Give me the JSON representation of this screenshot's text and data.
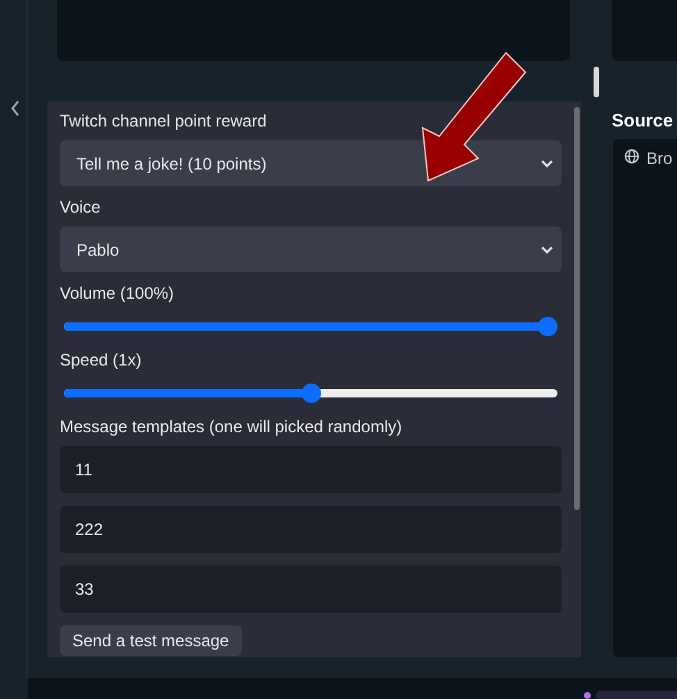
{
  "settings": {
    "fields": [
      {
        "kind": "select",
        "label": "Twitch channel point reward",
        "value": "Tell me a joke! (10 points)"
      },
      {
        "kind": "select",
        "label": "Voice",
        "value": "Pablo"
      },
      {
        "kind": "slider",
        "label": "Volume (100%)",
        "level": 0.98
      },
      {
        "kind": "slider",
        "label": "Speed (1x)",
        "level": 0.5
      }
    ],
    "templates": {
      "label": "Message templates (one will picked randomly)",
      "items": [
        "11",
        "222",
        "33"
      ]
    },
    "test_button": "Send a test message"
  },
  "sources": {
    "title": "Source",
    "items": [
      {
        "label": "Bro"
      }
    ]
  }
}
